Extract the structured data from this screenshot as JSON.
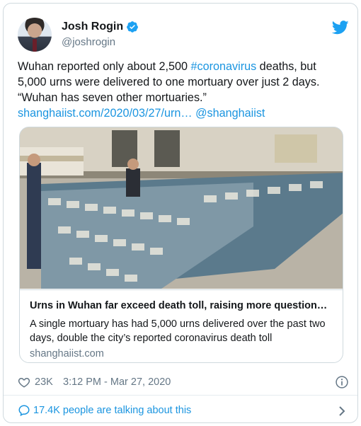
{
  "user": {
    "name": "Josh Rogin",
    "handle": "@joshrogin"
  },
  "tweet": {
    "text_1": "Wuhan reported only about 2,500 ",
    "hashtag": "#coronavirus",
    "text_2": " deaths, but 5,000 urns were delivered to one mortuary over just 2 days. “Wuhan has seven other mortuaries.” ",
    "link": "shanghaiist.com/2020/03/27/urn…",
    "mention": "@shanghaiist"
  },
  "link_card": {
    "title": "Urns in Wuhan far exceed death toll, raising more question…",
    "description": "A single mortuary has had 5,000 urns delivered over the past two days, double the city’s reported coronavirus death toll",
    "domain": "shanghaiist.com"
  },
  "meta": {
    "likes": "23K",
    "timestamp": "3:12 PM - Mar 27, 2020"
  },
  "footer": {
    "talking": "17.4K people are talking about this"
  },
  "colors": {
    "link": "#1b95e0",
    "secondary_text": "#657786",
    "border": "#cfd9de"
  }
}
